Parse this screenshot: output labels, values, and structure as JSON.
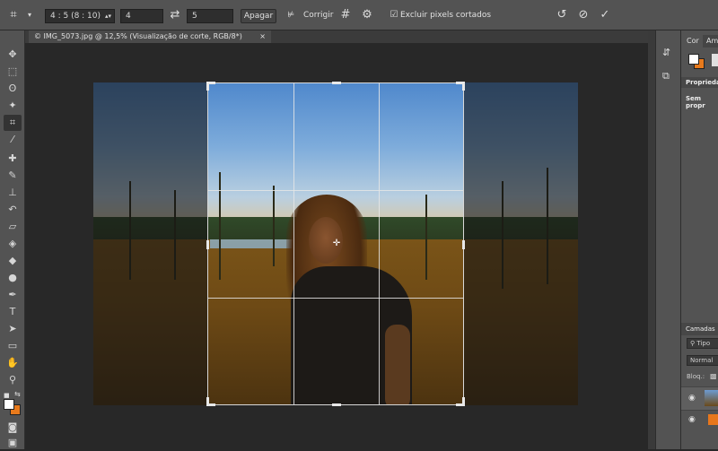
{
  "options_bar": {
    "ratio_preset": "4 : 5 (8 : 10)",
    "width_value": "4",
    "height_value": "5",
    "clear_label": "Apagar",
    "straighten_label": "Corrigir",
    "delete_cropped_label": "Excluir pixels cortados",
    "delete_cropped_checked": true
  },
  "document": {
    "tab_title": "© IMG_5073.jpg @ 12,5% (Visualização de corte, RGB/8*)",
    "close_glyph": "×"
  },
  "panels": {
    "color_tab": "Cor",
    "swatches_tab": "Am",
    "properties_title": "Propriedad",
    "properties_text": "Sem propr",
    "layers_tab": "Camadas",
    "layers_filter": "Tipo",
    "blend_mode": "Normal",
    "lock_label": "Bloq.:"
  },
  "colors": {
    "foreground": "#ffffff",
    "background": "#e87a1c",
    "layer_fill": "#e8771c"
  }
}
